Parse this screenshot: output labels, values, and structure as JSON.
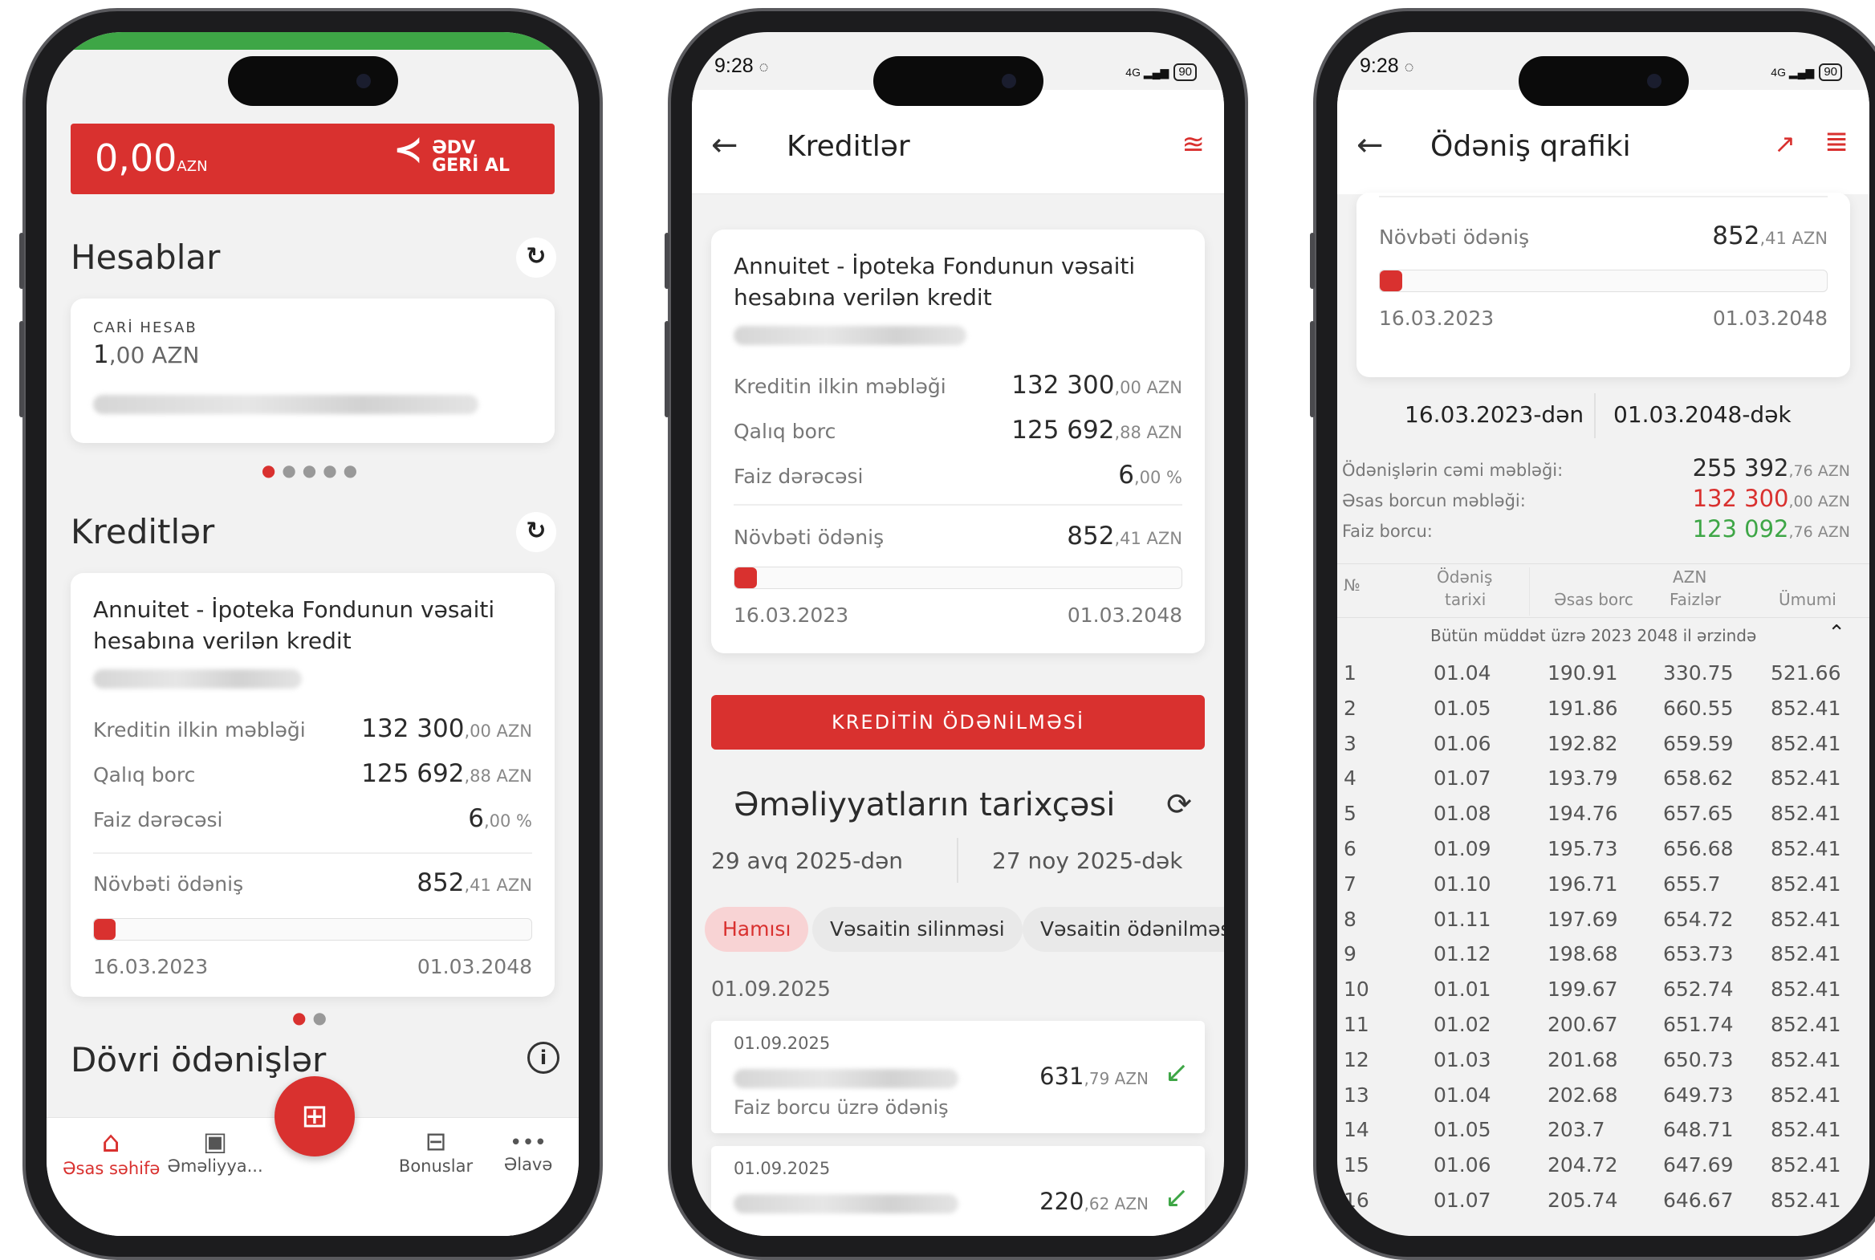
{
  "phone1": {
    "banner": {
      "amount": "0,00",
      "currency": "AZN",
      "logo_line1": "ƏDV",
      "logo_line2": "GERİ AL"
    },
    "accounts": {
      "title": "Hesablar",
      "card": {
        "label": "CARİ HESAB",
        "amount_int": "1",
        "amount_dec": ",00 AZN"
      }
    },
    "credits": {
      "title": "Kreditlər",
      "card": {
        "name": "Annuitet - İpoteka Fondunun vəsaiti hesabına verilən kredit",
        "rows": [
          {
            "label": "Kreditin ilkin məbləği",
            "int": "132 300",
            "dec": ",00 AZN"
          },
          {
            "label": "Qalıq borc",
            "int": "125 692",
            "dec": ",88 AZN"
          },
          {
            "label": "Faiz dərəcəsi",
            "int": "6",
            "dec": ",00 %"
          }
        ],
        "next_payment": {
          "label": "Növbəti ödəniş",
          "int": "852",
          "dec": ",41 AZN"
        },
        "progress": 0.05,
        "start_date": "16.03.2023",
        "end_date": "01.03.2048"
      }
    },
    "periodic": {
      "title": "Dövri ödənişlər"
    },
    "nav": [
      {
        "label": "Əsas səhifə",
        "icon": "home-icon"
      },
      {
        "label": "Əməliyya...",
        "icon": "wallet-icon"
      },
      {
        "label": "",
        "icon": "qr-icon"
      },
      {
        "label": "Bonuslar",
        "icon": "gift-icon"
      },
      {
        "label": "Əlavə",
        "icon": "more-icon"
      }
    ],
    "more_glyph": "•••"
  },
  "phone2": {
    "time": "9:28",
    "battery": "90",
    "title": "Kreditlər",
    "card": {
      "name": "Annuitet - İpoteka Fondunun vəsaiti hesabına verilən kredit",
      "rows": [
        {
          "label": "Kreditin ilkin məbləği",
          "int": "132 300",
          "dec": ",00 AZN"
        },
        {
          "label": "Qalıq borc",
          "int": "125 692",
          "dec": ",88 AZN"
        },
        {
          "label": "Faiz dərəcəsi",
          "int": "6",
          "dec": ",00 %"
        }
      ],
      "next_payment": {
        "label": "Növbəti ödəniş",
        "int": "852",
        "dec": ",41 AZN"
      },
      "progress": 0.05,
      "start_date": "16.03.2023",
      "end_date": "01.03.2048"
    },
    "pay_button": "KREDİTİN ÖDƏNİLMƏSİ",
    "history": {
      "title": "Əməliyyatların tarixçəsi",
      "from": "29 avq 2025-dən",
      "to": "27 noy 2025-dək",
      "chips": [
        "Hamısı",
        "Vəsaitin silinməsi",
        "Vəsaitin ödənilməsi"
      ],
      "group_date": "01.09.2025",
      "items": [
        {
          "date": "01.09.2025",
          "int": "631",
          "dec": ",79 AZN",
          "desc": "Faiz borcu üzrə ödəniş"
        },
        {
          "date": "01.09.2025",
          "int": "220",
          "dec": ",62 AZN",
          "desc": ""
        }
      ]
    }
  },
  "phone3": {
    "time": "9:28",
    "battery": "90",
    "title": "Ödəniş qrafiki",
    "next_payment": {
      "label": "Növbəti ödəniş",
      "int": "852",
      "dec": ",41 AZN"
    },
    "progress": 0.05,
    "start_date": "16.03.2023",
    "end_date": "01.03.2048",
    "range_from": "16.03.2023-dən",
    "range_to": "01.03.2048-dək",
    "summary": [
      {
        "label": "Ödənişlərin cəmi məbləği:",
        "int": "255 392",
        "dec": ",76 AZN",
        "color": "#2b2b2b"
      },
      {
        "label": "Əsas borcun məbləği:",
        "int": "132 300",
        "dec": ",00 AZN",
        "color": "#d9312f"
      },
      {
        "label": "Faiz borcu:",
        "int": "123 092",
        "dec": ",76 AZN",
        "color": "#3ea646"
      }
    ],
    "table": {
      "col_no": "№",
      "col_date_1": "Ödəniş",
      "col_date_2": "tarixi",
      "col_group": "AZN",
      "col_principal": "Əsas borc",
      "col_interest": "Faizlər",
      "col_total": "Ümumi",
      "period_label": "Bütün müddət üzrə 2023 2048 il ərzində",
      "rows": [
        [
          "1",
          "01.04",
          "190.91",
          "330.75",
          "521.66"
        ],
        [
          "2",
          "01.05",
          "191.86",
          "660.55",
          "852.41"
        ],
        [
          "3",
          "01.06",
          "192.82",
          "659.59",
          "852.41"
        ],
        [
          "4",
          "01.07",
          "193.79",
          "658.62",
          "852.41"
        ],
        [
          "5",
          "01.08",
          "194.76",
          "657.65",
          "852.41"
        ],
        [
          "6",
          "01.09",
          "195.73",
          "656.68",
          "852.41"
        ],
        [
          "7",
          "01.10",
          "196.71",
          "655.7",
          "852.41"
        ],
        [
          "8",
          "01.11",
          "197.69",
          "654.72",
          "852.41"
        ],
        [
          "9",
          "01.12",
          "198.68",
          "653.73",
          "852.41"
        ],
        [
          "10",
          "01.01",
          "199.67",
          "652.74",
          "852.41"
        ],
        [
          "11",
          "01.02",
          "200.67",
          "651.74",
          "852.41"
        ],
        [
          "12",
          "01.03",
          "201.68",
          "650.73",
          "852.41"
        ],
        [
          "13",
          "01.04",
          "202.68",
          "649.73",
          "852.41"
        ],
        [
          "14",
          "01.05",
          "203.7",
          "648.71",
          "852.41"
        ],
        [
          "15",
          "01.06",
          "204.72",
          "647.69",
          "852.41"
        ],
        [
          "16",
          "01.07",
          "205.74",
          "646.67",
          "852.41"
        ]
      ]
    }
  },
  "colors": {
    "accent": "#d9312f",
    "green": "#3ea646",
    "background": "#f2f2f2"
  }
}
